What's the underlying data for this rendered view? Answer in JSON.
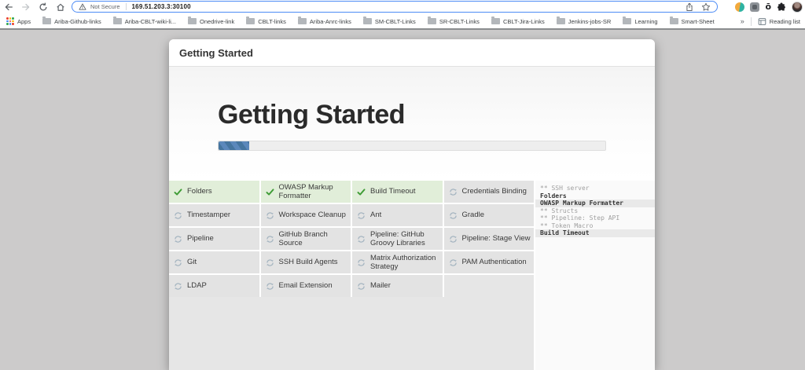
{
  "browser": {
    "nav": {
      "back_icon": "back-arrow",
      "forward_icon": "forward-arrow",
      "reload_icon": "reload",
      "home_icon": "home"
    },
    "address_bar": {
      "security_warning": "Not Secure",
      "url": "169.51.203.3:30100",
      "share_icon": "share",
      "bookmark_icon": "star"
    },
    "bookmarks": {
      "apps_label": "Apps",
      "items": [
        "Ariba-Github-links",
        "Ariba-CBLT-wiki-li...",
        "Onedrive-link",
        "CBLT-links",
        "Ariba-Anrc-links",
        "SM-CBLT-Links",
        "SR-CBLT-Links",
        "CBLT-Jira-Links",
        "Jenkins-jobs-SR",
        "Learning",
        "Smart-Sheet"
      ],
      "overflow_chevron": "»",
      "reading_list_label": "Reading list"
    }
  },
  "wizard": {
    "header_title": "Getting Started",
    "hero_title": "Getting Started",
    "progress_percent": 8,
    "plugins": [
      {
        "name": "Folders",
        "status": "done"
      },
      {
        "name": "OWASP Markup Formatter",
        "status": "done"
      },
      {
        "name": "Build Timeout",
        "status": "done"
      },
      {
        "name": "Credentials Binding",
        "status": "installing"
      },
      {
        "name": "Timestamper",
        "status": "installing"
      },
      {
        "name": "Workspace Cleanup",
        "status": "installing"
      },
      {
        "name": "Ant",
        "status": "installing"
      },
      {
        "name": "Gradle",
        "status": "installing"
      },
      {
        "name": "Pipeline",
        "status": "installing"
      },
      {
        "name": "GitHub Branch Source",
        "status": "installing"
      },
      {
        "name": "Pipeline: GitHub Groovy Libraries",
        "status": "installing"
      },
      {
        "name": "Pipeline: Stage View",
        "status": "installing"
      },
      {
        "name": "Git",
        "status": "installing"
      },
      {
        "name": "SSH Build Agents",
        "status": "installing"
      },
      {
        "name": "Matrix Authorization Strategy",
        "status": "installing"
      },
      {
        "name": "PAM Authentication",
        "status": "installing"
      },
      {
        "name": "LDAP",
        "status": "installing"
      },
      {
        "name": "Email Extension",
        "status": "installing"
      },
      {
        "name": "Mailer",
        "status": "installing"
      }
    ],
    "console_lines": [
      {
        "text": "** SSH server",
        "style": "dependency"
      },
      {
        "text": "Folders",
        "style": "active"
      },
      {
        "text": "OWASP Markup Formatter",
        "style": "active-highlight"
      },
      {
        "text": "** Structs",
        "style": "dependency"
      },
      {
        "text": "** Pipeline: Step API",
        "style": "dependency"
      },
      {
        "text": "** Token Macro",
        "style": "dependency"
      },
      {
        "text": "Build Timeout",
        "style": "active-highlight"
      }
    ]
  },
  "colors": {
    "success_check": "#3e9c35",
    "success_cell_bg": "#e1eed9",
    "pending_cell_bg": "#e3e3e3",
    "progress_blue": "#46759f",
    "omnibox_focus_blue": "#4c8bf5",
    "page_backdrop": "#cccbcb"
  }
}
